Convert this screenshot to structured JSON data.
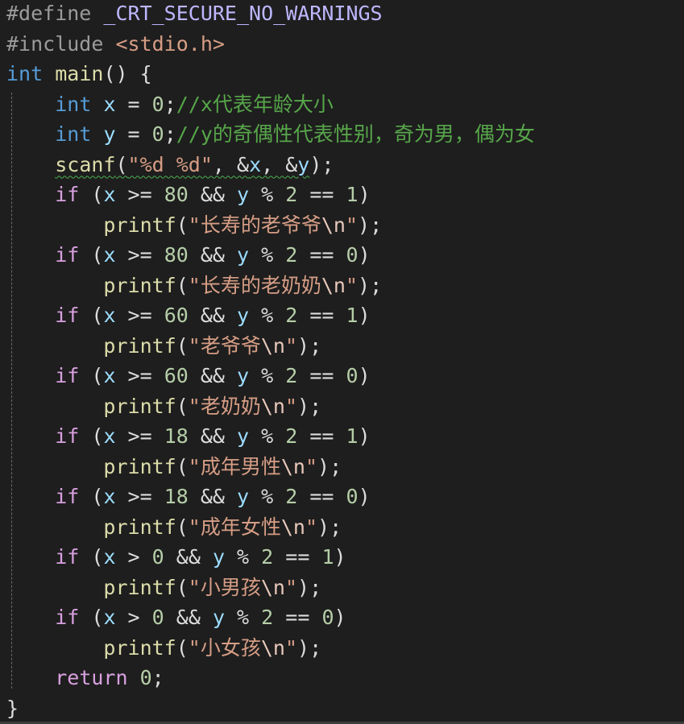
{
  "colors": {
    "background": "#1e1e1e",
    "default_text": "#dcdcdc",
    "keyword": "#569cd6",
    "control_keyword": "#d8a0df",
    "function": "#dcdcaa",
    "variable": "#9cdcfe",
    "string": "#d69d85",
    "escape": "#e8c9bb",
    "comment": "#57a64a",
    "number": "#b5cea8",
    "preprocessor": "#9b9b9b",
    "macro": "#beb7ff",
    "include_path": "#d69d85",
    "squiggle": "#4caf50"
  },
  "code_lines": [
    [
      {
        "text": "#define ",
        "color": "#9b9b9b"
      },
      {
        "text": "_CRT_SECURE_NO_WARNINGS",
        "color": "#beb7ff"
      }
    ],
    [
      {
        "text": "#include ",
        "color": "#9b9b9b"
      },
      {
        "text": "<stdio.h>",
        "color": "#d69d85"
      }
    ],
    [
      {
        "text": "int",
        "color": "#569cd6"
      },
      {
        "text": " ",
        "color": "#dcdcdc"
      },
      {
        "text": "main",
        "color": "#dcdcaa"
      },
      {
        "text": "() {",
        "color": "#dcdcdc"
      }
    ],
    [
      {
        "text": "    ",
        "color": "#dcdcdc"
      },
      {
        "text": "int",
        "color": "#569cd6"
      },
      {
        "text": " ",
        "color": "#dcdcdc"
      },
      {
        "text": "x",
        "color": "#9cdcfe"
      },
      {
        "text": " = ",
        "color": "#dcdcdc"
      },
      {
        "text": "0",
        "color": "#b5cea8"
      },
      {
        "text": ";",
        "color": "#dcdcdc"
      },
      {
        "text": "//x代表年龄大小",
        "color": "#57a64a"
      }
    ],
    [
      {
        "text": "    ",
        "color": "#dcdcdc"
      },
      {
        "text": "int",
        "color": "#569cd6"
      },
      {
        "text": " ",
        "color": "#dcdcdc"
      },
      {
        "text": "y",
        "color": "#9cdcfe"
      },
      {
        "text": " = ",
        "color": "#dcdcdc"
      },
      {
        "text": "0",
        "color": "#b5cea8"
      },
      {
        "text": ";",
        "color": "#dcdcdc"
      },
      {
        "text": "//y的奇偶性代表性别，奇为男，偶为女",
        "color": "#57a64a"
      }
    ],
    [
      {
        "text": "    ",
        "color": "#dcdcdc"
      },
      {
        "text": "scanf",
        "color": "#dcdcaa",
        "squiggle": true
      },
      {
        "text": "(",
        "color": "#dcdcdc",
        "squiggle": true
      },
      {
        "text": "\"%d %d\"",
        "color": "#d69d85",
        "squiggle": true
      },
      {
        "text": ", &",
        "color": "#dcdcdc",
        "squiggle": true
      },
      {
        "text": "x",
        "color": "#9cdcfe",
        "squiggle": true
      },
      {
        "text": ", &",
        "color": "#dcdcdc",
        "squiggle": true
      },
      {
        "text": "y",
        "color": "#9cdcfe",
        "squiggle": true
      },
      {
        "text": ");",
        "color": "#dcdcdc"
      }
    ],
    [
      {
        "text": "    ",
        "color": "#dcdcdc"
      },
      {
        "text": "if",
        "color": "#d8a0df"
      },
      {
        "text": " (",
        "color": "#dcdcdc"
      },
      {
        "text": "x",
        "color": "#9cdcfe"
      },
      {
        "text": " >= ",
        "color": "#dcdcdc"
      },
      {
        "text": "80",
        "color": "#b5cea8"
      },
      {
        "text": " && ",
        "color": "#dcdcdc"
      },
      {
        "text": "y",
        "color": "#9cdcfe"
      },
      {
        "text": " % ",
        "color": "#dcdcdc"
      },
      {
        "text": "2",
        "color": "#b5cea8"
      },
      {
        "text": " == ",
        "color": "#dcdcdc"
      },
      {
        "text": "1",
        "color": "#b5cea8"
      },
      {
        "text": ")",
        "color": "#dcdcdc"
      }
    ],
    [
      {
        "text": "        ",
        "color": "#dcdcdc"
      },
      {
        "text": "printf",
        "color": "#dcdcaa"
      },
      {
        "text": "(",
        "color": "#dcdcdc"
      },
      {
        "text": "\"长寿的老爷爷",
        "color": "#d69d85"
      },
      {
        "text": "\\n",
        "color": "#e8c9bb"
      },
      {
        "text": "\"",
        "color": "#d69d85"
      },
      {
        "text": ");",
        "color": "#dcdcdc"
      }
    ],
    [
      {
        "text": "    ",
        "color": "#dcdcdc"
      },
      {
        "text": "if",
        "color": "#d8a0df"
      },
      {
        "text": " (",
        "color": "#dcdcdc"
      },
      {
        "text": "x",
        "color": "#9cdcfe"
      },
      {
        "text": " >= ",
        "color": "#dcdcdc"
      },
      {
        "text": "80",
        "color": "#b5cea8"
      },
      {
        "text": " && ",
        "color": "#dcdcdc"
      },
      {
        "text": "y",
        "color": "#9cdcfe"
      },
      {
        "text": " % ",
        "color": "#dcdcdc"
      },
      {
        "text": "2",
        "color": "#b5cea8"
      },
      {
        "text": " == ",
        "color": "#dcdcdc"
      },
      {
        "text": "0",
        "color": "#b5cea8"
      },
      {
        "text": ")",
        "color": "#dcdcdc"
      }
    ],
    [
      {
        "text": "        ",
        "color": "#dcdcdc"
      },
      {
        "text": "printf",
        "color": "#dcdcaa"
      },
      {
        "text": "(",
        "color": "#dcdcdc"
      },
      {
        "text": "\"长寿的老奶奶",
        "color": "#d69d85"
      },
      {
        "text": "\\n",
        "color": "#e8c9bb"
      },
      {
        "text": "\"",
        "color": "#d69d85"
      },
      {
        "text": ");",
        "color": "#dcdcdc"
      }
    ],
    [
      {
        "text": "    ",
        "color": "#dcdcdc"
      },
      {
        "text": "if",
        "color": "#d8a0df"
      },
      {
        "text": " (",
        "color": "#dcdcdc"
      },
      {
        "text": "x",
        "color": "#9cdcfe"
      },
      {
        "text": " >= ",
        "color": "#dcdcdc"
      },
      {
        "text": "60",
        "color": "#b5cea8"
      },
      {
        "text": " && ",
        "color": "#dcdcdc"
      },
      {
        "text": "y",
        "color": "#9cdcfe"
      },
      {
        "text": " % ",
        "color": "#dcdcdc"
      },
      {
        "text": "2",
        "color": "#b5cea8"
      },
      {
        "text": " == ",
        "color": "#dcdcdc"
      },
      {
        "text": "1",
        "color": "#b5cea8"
      },
      {
        "text": ")",
        "color": "#dcdcdc"
      }
    ],
    [
      {
        "text": "        ",
        "color": "#dcdcdc"
      },
      {
        "text": "printf",
        "color": "#dcdcaa"
      },
      {
        "text": "(",
        "color": "#dcdcdc"
      },
      {
        "text": "\"老爷爷",
        "color": "#d69d85"
      },
      {
        "text": "\\n",
        "color": "#e8c9bb"
      },
      {
        "text": "\"",
        "color": "#d69d85"
      },
      {
        "text": ");",
        "color": "#dcdcdc"
      }
    ],
    [
      {
        "text": "    ",
        "color": "#dcdcdc"
      },
      {
        "text": "if",
        "color": "#d8a0df"
      },
      {
        "text": " (",
        "color": "#dcdcdc"
      },
      {
        "text": "x",
        "color": "#9cdcfe"
      },
      {
        "text": " >= ",
        "color": "#dcdcdc"
      },
      {
        "text": "60",
        "color": "#b5cea8"
      },
      {
        "text": " && ",
        "color": "#dcdcdc"
      },
      {
        "text": "y",
        "color": "#9cdcfe"
      },
      {
        "text": " % ",
        "color": "#dcdcdc"
      },
      {
        "text": "2",
        "color": "#b5cea8"
      },
      {
        "text": " == ",
        "color": "#dcdcdc"
      },
      {
        "text": "0",
        "color": "#b5cea8"
      },
      {
        "text": ")",
        "color": "#dcdcdc"
      }
    ],
    [
      {
        "text": "        ",
        "color": "#dcdcdc"
      },
      {
        "text": "printf",
        "color": "#dcdcaa"
      },
      {
        "text": "(",
        "color": "#dcdcdc"
      },
      {
        "text": "\"老奶奶",
        "color": "#d69d85"
      },
      {
        "text": "\\n",
        "color": "#e8c9bb"
      },
      {
        "text": "\"",
        "color": "#d69d85"
      },
      {
        "text": ");",
        "color": "#dcdcdc"
      }
    ],
    [
      {
        "text": "    ",
        "color": "#dcdcdc"
      },
      {
        "text": "if",
        "color": "#d8a0df"
      },
      {
        "text": " (",
        "color": "#dcdcdc"
      },
      {
        "text": "x",
        "color": "#9cdcfe"
      },
      {
        "text": " >= ",
        "color": "#dcdcdc"
      },
      {
        "text": "18",
        "color": "#b5cea8"
      },
      {
        "text": " && ",
        "color": "#dcdcdc"
      },
      {
        "text": "y",
        "color": "#9cdcfe"
      },
      {
        "text": " % ",
        "color": "#dcdcdc"
      },
      {
        "text": "2",
        "color": "#b5cea8"
      },
      {
        "text": " == ",
        "color": "#dcdcdc"
      },
      {
        "text": "1",
        "color": "#b5cea8"
      },
      {
        "text": ")",
        "color": "#dcdcdc"
      }
    ],
    [
      {
        "text": "        ",
        "color": "#dcdcdc"
      },
      {
        "text": "printf",
        "color": "#dcdcaa"
      },
      {
        "text": "(",
        "color": "#dcdcdc"
      },
      {
        "text": "\"成年男性",
        "color": "#d69d85"
      },
      {
        "text": "\\n",
        "color": "#e8c9bb"
      },
      {
        "text": "\"",
        "color": "#d69d85"
      },
      {
        "text": ");",
        "color": "#dcdcdc"
      }
    ],
    [
      {
        "text": "    ",
        "color": "#dcdcdc"
      },
      {
        "text": "if",
        "color": "#d8a0df"
      },
      {
        "text": " (",
        "color": "#dcdcdc"
      },
      {
        "text": "x",
        "color": "#9cdcfe"
      },
      {
        "text": " >= ",
        "color": "#dcdcdc"
      },
      {
        "text": "18",
        "color": "#b5cea8"
      },
      {
        "text": " && ",
        "color": "#dcdcdc"
      },
      {
        "text": "y",
        "color": "#9cdcfe"
      },
      {
        "text": " % ",
        "color": "#dcdcdc"
      },
      {
        "text": "2",
        "color": "#b5cea8"
      },
      {
        "text": " == ",
        "color": "#dcdcdc"
      },
      {
        "text": "0",
        "color": "#b5cea8"
      },
      {
        "text": ")",
        "color": "#dcdcdc"
      }
    ],
    [
      {
        "text": "        ",
        "color": "#dcdcdc"
      },
      {
        "text": "printf",
        "color": "#dcdcaa"
      },
      {
        "text": "(",
        "color": "#dcdcdc"
      },
      {
        "text": "\"成年女性",
        "color": "#d69d85"
      },
      {
        "text": "\\n",
        "color": "#e8c9bb"
      },
      {
        "text": "\"",
        "color": "#d69d85"
      },
      {
        "text": ");",
        "color": "#dcdcdc"
      }
    ],
    [
      {
        "text": "    ",
        "color": "#dcdcdc"
      },
      {
        "text": "if",
        "color": "#d8a0df"
      },
      {
        "text": " (",
        "color": "#dcdcdc"
      },
      {
        "text": "x",
        "color": "#9cdcfe"
      },
      {
        "text": " > ",
        "color": "#dcdcdc"
      },
      {
        "text": "0",
        "color": "#b5cea8"
      },
      {
        "text": " && ",
        "color": "#dcdcdc"
      },
      {
        "text": "y",
        "color": "#9cdcfe"
      },
      {
        "text": " % ",
        "color": "#dcdcdc"
      },
      {
        "text": "2",
        "color": "#b5cea8"
      },
      {
        "text": " == ",
        "color": "#dcdcdc"
      },
      {
        "text": "1",
        "color": "#b5cea8"
      },
      {
        "text": ")",
        "color": "#dcdcdc"
      }
    ],
    [
      {
        "text": "        ",
        "color": "#dcdcdc"
      },
      {
        "text": "printf",
        "color": "#dcdcaa"
      },
      {
        "text": "(",
        "color": "#dcdcdc"
      },
      {
        "text": "\"小男孩",
        "color": "#d69d85"
      },
      {
        "text": "\\n",
        "color": "#e8c9bb"
      },
      {
        "text": "\"",
        "color": "#d69d85"
      },
      {
        "text": ");",
        "color": "#dcdcdc"
      }
    ],
    [
      {
        "text": "    ",
        "color": "#dcdcdc"
      },
      {
        "text": "if",
        "color": "#d8a0df"
      },
      {
        "text": " (",
        "color": "#dcdcdc"
      },
      {
        "text": "x",
        "color": "#9cdcfe"
      },
      {
        "text": " > ",
        "color": "#dcdcdc"
      },
      {
        "text": "0",
        "color": "#b5cea8"
      },
      {
        "text": " && ",
        "color": "#dcdcdc"
      },
      {
        "text": "y",
        "color": "#9cdcfe"
      },
      {
        "text": " % ",
        "color": "#dcdcdc"
      },
      {
        "text": "2",
        "color": "#b5cea8"
      },
      {
        "text": " == ",
        "color": "#dcdcdc"
      },
      {
        "text": "0",
        "color": "#b5cea8"
      },
      {
        "text": ")",
        "color": "#dcdcdc"
      }
    ],
    [
      {
        "text": "        ",
        "color": "#dcdcdc"
      },
      {
        "text": "printf",
        "color": "#dcdcaa"
      },
      {
        "text": "(",
        "color": "#dcdcdc"
      },
      {
        "text": "\"小女孩",
        "color": "#d69d85"
      },
      {
        "text": "\\n",
        "color": "#e8c9bb"
      },
      {
        "text": "\"",
        "color": "#d69d85"
      },
      {
        "text": ");",
        "color": "#dcdcdc"
      }
    ],
    [
      {
        "text": "    ",
        "color": "#dcdcdc"
      },
      {
        "text": "return",
        "color": "#d8a0df"
      },
      {
        "text": " ",
        "color": "#dcdcdc"
      },
      {
        "text": "0",
        "color": "#b5cea8"
      },
      {
        "text": ";",
        "color": "#dcdcdc"
      }
    ],
    [
      {
        "text": "}",
        "color": "#dcdcdc"
      }
    ]
  ]
}
